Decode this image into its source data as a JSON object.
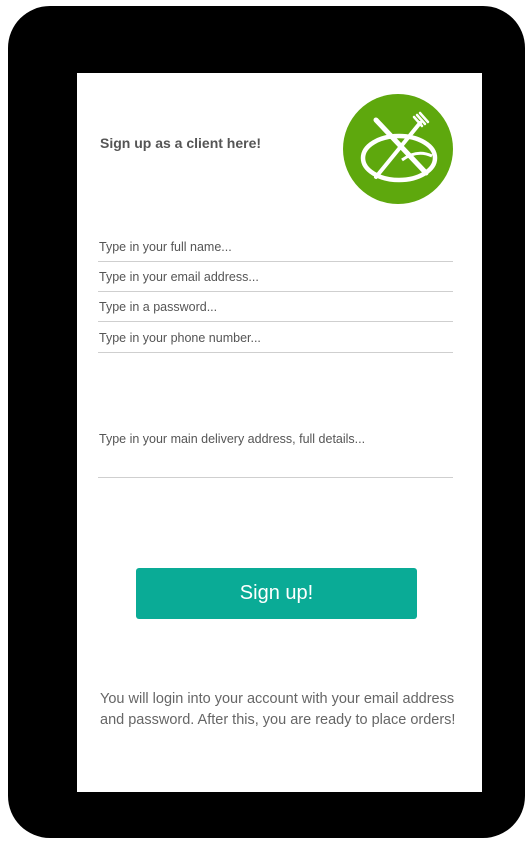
{
  "form": {
    "heading": "Sign up as a client here!",
    "full_name_placeholder": "Type in your full name...",
    "email_placeholder": "Type in your email address...",
    "password_placeholder": "Type in a password...",
    "phone_placeholder": "Type in your phone number...",
    "address_placeholder": "Type in your main delivery address, full details...",
    "signup_label": "Sign up!",
    "note": "You will login into your account with your email address and password. After this, you are ready to place orders!"
  },
  "logo": {
    "icon": "plate-fork-knife-icon",
    "color": "#5ea80d"
  },
  "colors": {
    "device_frame": "#000000",
    "button": "#0aab96"
  }
}
